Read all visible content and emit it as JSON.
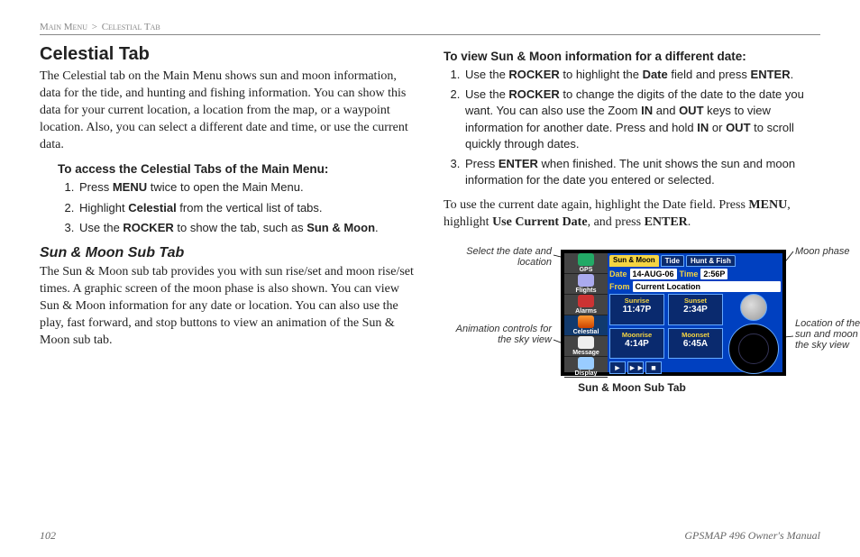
{
  "breadcrumb": {
    "a": "Main Menu",
    "sep": ">",
    "b": "Celestial Tab"
  },
  "left": {
    "h1": "Celestial Tab",
    "intro": "The Celestial tab on the Main Menu shows sun and moon information, data for the tide, and hunting and fishing information. You can show this data for your current location, a location from the map, or a waypoint location. Also, you can select a different date and time, or use the current data.",
    "proc1_head": "To access the Celestial Tabs of the Main Menu:",
    "proc1_1a": "Press ",
    "proc1_1b": "MENU",
    "proc1_1c": " twice to open the Main Menu.",
    "proc1_2a": "Highlight ",
    "proc1_2b": "Celestial",
    "proc1_2c": " from the vertical list of tabs.",
    "proc1_3a": "Use the ",
    "proc1_3b": "ROCKER",
    "proc1_3c": " to show the tab, such as ",
    "proc1_3d": "Sun & Moon",
    "proc1_3e": ".",
    "h2": "Sun & Moon Sub Tab",
    "sub_body": "The Sun & Moon sub tab provides you with sun rise/set and moon rise/set times. A graphic screen of the moon phase is also shown. You can view Sun & Moon information for any date or location. You can also use the play, fast forward, and stop buttons to view an animation of the Sun & Moon sub tab."
  },
  "right": {
    "proc2_head": "To view Sun & Moon information for a different date:",
    "proc2_1a": "Use the ",
    "proc2_1b": "ROCKER",
    "proc2_1c": " to highlight the ",
    "proc2_1d": "Date",
    "proc2_1e": " field and press ",
    "proc2_1f": "ENTER",
    "proc2_1g": ".",
    "proc2_2a": "Use the ",
    "proc2_2b": "ROCKER",
    "proc2_2c": " to change the digits of the date to the date you want. You can also use the Zoom ",
    "proc2_2d": "IN",
    "proc2_2e": " and ",
    "proc2_2f": "OUT",
    "proc2_2g": " keys to view information for another date. Press and hold ",
    "proc2_2h": "IN",
    "proc2_2i": " or ",
    "proc2_2j": "OUT",
    "proc2_2k": " to scroll quickly through dates.",
    "proc2_3a": "Press ",
    "proc2_3b": "ENTER",
    "proc2_3c": " when finished. The unit shows the sun and moon information for the date you entered or selected.",
    "after_a": "To use the current date again, highlight the Date field. Press ",
    "after_b": "MENU",
    "after_c": ", highlight ",
    "after_d": "Use Current Date",
    "after_e": ", and press ",
    "after_f": "ENTER",
    "after_g": "."
  },
  "figure": {
    "callout_tl": "Select the date and location",
    "callout_bl": "Animation controls for the sky view",
    "callout_tr": "Moon phase",
    "callout_br": "Location of the sun and moon in the sky view",
    "caption": "Sun & Moon Sub Tab",
    "side": {
      "gps": "GPS",
      "flights": "Flights",
      "alarms": "Alarms",
      "celestial": "Celestial",
      "message": "Message",
      "display": "Display"
    },
    "tabs": {
      "sm": "Sun & Moon",
      "tide": "Tide",
      "hf": "Hunt & Fish"
    },
    "labels": {
      "date": "Date",
      "time": "Time",
      "from": "From"
    },
    "values": {
      "date": "14-AUG-06",
      "time": "2:56P",
      "from": "Current Location",
      "sunrise_h": "Sunrise",
      "sunrise_v": "11:47P",
      "sunset_h": "Sunset",
      "sunset_v": "2:34P",
      "moonrise_h": "Moonrise",
      "moonrise_v": "4:14P",
      "moonset_h": "Moonset",
      "moonset_v": "6:45A"
    },
    "controls": {
      "play": "►",
      "ff": "►►",
      "stop": "■"
    }
  },
  "footer": {
    "page": "102",
    "manual": "GPSMAP 496 Owner's Manual"
  }
}
